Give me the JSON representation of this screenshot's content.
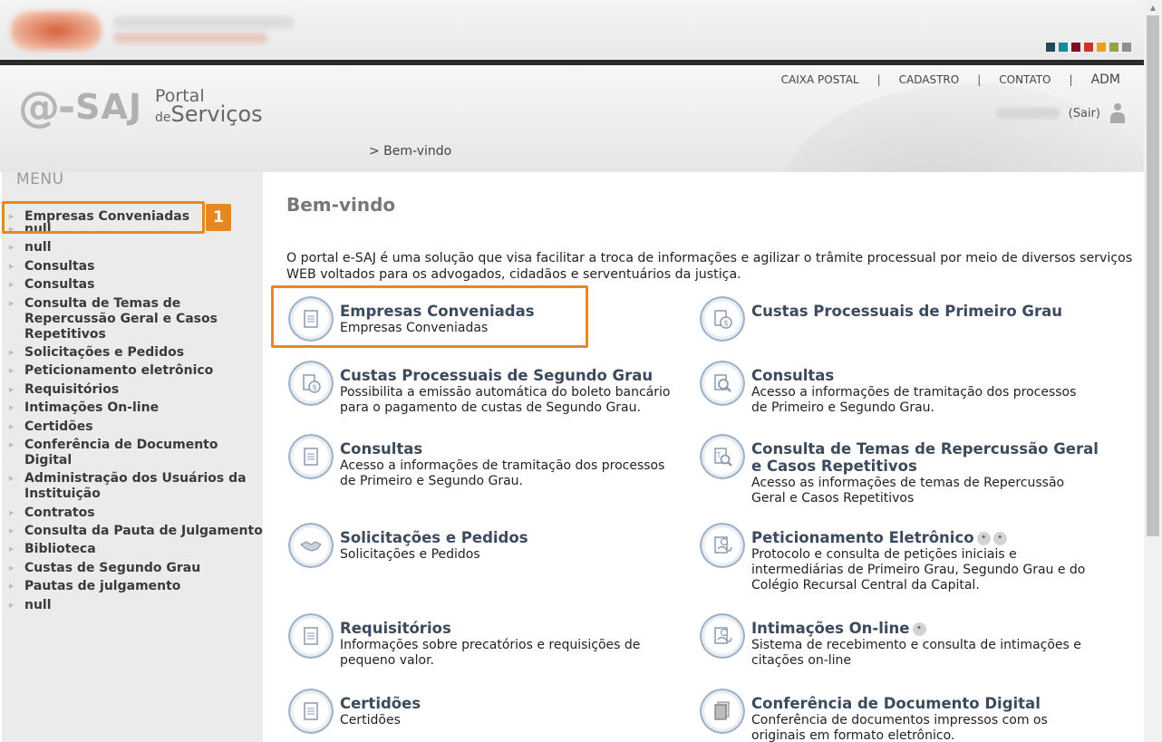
{
  "top": {
    "swatch_colors": [
      "#1e4a5a",
      "#17899b",
      "#7a1020",
      "#c0392b",
      "#e8a21f",
      "#9aa04a",
      "#8e8e8e"
    ]
  },
  "header": {
    "logo_e": "@-",
    "logo_saj": "SAJ",
    "logo_portal": "Portal",
    "logo_de": "de",
    "logo_servicos": "Serviços",
    "nav": [
      "CAIXA POSTAL",
      "CADASTRO",
      "CONTATO",
      "ADM"
    ],
    "nav_separator": "|",
    "sair": "(Sair)",
    "breadcrumb": "> Bem-vindo"
  },
  "sidebar": {
    "title": "MENU",
    "items": [
      "Empresas Conveniadas",
      "null",
      "null",
      "Consultas",
      "Consultas",
      "Consulta de Temas de Repercussão Geral e Casos Repetitivos",
      "Solicitações e Pedidos",
      "Peticionamento eletrônico",
      "Requisitórios",
      "Intimações On-line",
      "Certidões",
      "Conferência de Documento Digital",
      "Administração dos Usuários da Instituição",
      "Contratos",
      "Consulta da Pauta de Julgamento",
      "Biblioteca",
      "Custas de Segundo Grau",
      "Pautas de julgamento",
      "null"
    ],
    "annotation_badge": "1"
  },
  "main": {
    "title": "Bem-vindo",
    "intro": "O portal e-SAJ é uma solução que visa facilitar a troca de informações e agilizar o trâmite processual por meio de diversos serviços WEB voltados para os advogados, cidadãos e serventuários da justiça.",
    "cards": [
      {
        "title": "Empresas Conveniadas",
        "desc": "Empresas Conveniadas",
        "icon": "document-icon"
      },
      {
        "title": "Custas Processuais de Primeiro Grau",
        "desc": "",
        "icon": "dollar-document-icon"
      },
      {
        "title": "Custas Processuais de Segundo Grau",
        "desc": "Possibilita a emissão automática do boleto bancário para o pagamento de custas de Segundo Grau.",
        "icon": "dollar-document-icon"
      },
      {
        "title": "Consultas",
        "desc": "Acesso a informações de tramitação dos processos de Primeiro e Segundo Grau.",
        "icon": "magnifier-document-icon"
      },
      {
        "title": "Consultas",
        "desc": "Acesso a informações de tramitação dos processos de Primeiro e Segundo Grau.",
        "icon": "document-icon"
      },
      {
        "title": "Consulta de Temas de Repercussão Geral e Casos Repetitivos",
        "desc": "Acesso as informações de temas de Repercussão Geral e Casos Repetitivos",
        "icon": "search-document-icon"
      },
      {
        "title": "Solicitações e Pedidos",
        "desc": "Solicitações e Pedidos",
        "icon": "handshake-icon"
      },
      {
        "title": "Peticionamento Eletrônico",
        "desc": "Protocolo e consulta de petições iniciais e intermediárias de Primeiro Grau, Segundo Grau e do Colégio Recursal Central da Capital.",
        "icon": "signed-document-icon"
      },
      {
        "title": "Requisitórios",
        "desc": "Informações sobre precatórios e requisições de pequeno valor.",
        "icon": "document-icon"
      },
      {
        "title": "Intimações On-line",
        "desc": "Sistema de recebimento e consulta de intimações e citações on-line",
        "icon": "signed-document-icon"
      },
      {
        "title": "Certidões",
        "desc": "Certidões",
        "icon": "document-icon"
      },
      {
        "title": "Conferência de Documento Digital",
        "desc": "Conferência de documentos impressos com os originais em formato eletrônico.",
        "icon": "stacked-documents-icon"
      }
    ]
  }
}
